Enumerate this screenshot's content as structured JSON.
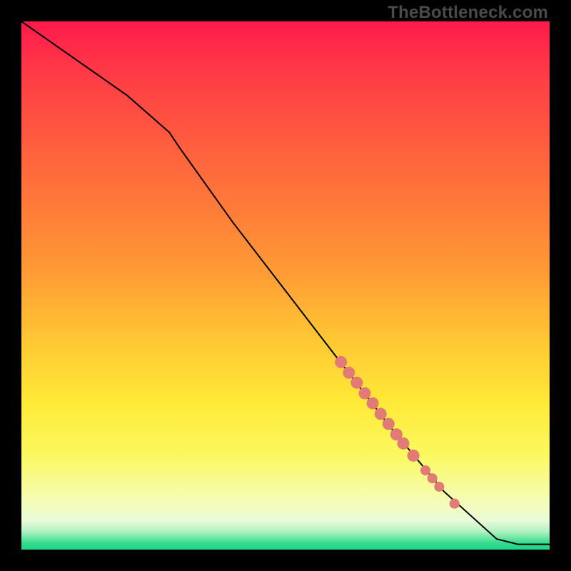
{
  "watermark": "TheBottleneck.com",
  "colors": {
    "background": "#000000",
    "line": "#000000",
    "marker": "#e27a76",
    "gradient_stops": [
      {
        "offset": 0.0,
        "color": "#ff1a4b"
      },
      {
        "offset": 0.1,
        "color": "#ff3b46"
      },
      {
        "offset": 0.22,
        "color": "#ff5a3f"
      },
      {
        "offset": 0.35,
        "color": "#ff7a39"
      },
      {
        "offset": 0.48,
        "color": "#ff9d35"
      },
      {
        "offset": 0.6,
        "color": "#ffc634"
      },
      {
        "offset": 0.72,
        "color": "#ffe937"
      },
      {
        "offset": 0.82,
        "color": "#fbf95f"
      },
      {
        "offset": 0.9,
        "color": "#f6fcae"
      },
      {
        "offset": 0.945,
        "color": "#eafbd8"
      },
      {
        "offset": 0.965,
        "color": "#b4f2c3"
      },
      {
        "offset": 0.978,
        "color": "#6be7a2"
      },
      {
        "offset": 0.988,
        "color": "#33db8e"
      },
      {
        "offset": 1.0,
        "color": "#1fd488"
      }
    ]
  },
  "chart_data": {
    "type": "line",
    "title": "",
    "xlabel": "",
    "ylabel": "",
    "xlim": [
      0,
      100
    ],
    "ylim": [
      0,
      100
    ],
    "grid": false,
    "series": [
      {
        "name": "curve",
        "x": [
          0,
          10,
          20,
          28,
          30,
          40,
          50,
          60,
          70,
          80,
          90,
          94,
          100
        ],
        "y": [
          100,
          93,
          86,
          79,
          76,
          62,
          49,
          36,
          23,
          11,
          2,
          1,
          1
        ]
      }
    ],
    "markers": {
      "name": "highlight-segment",
      "color": "#e27a76",
      "points": [
        {
          "x": 60.5,
          "y": 35.5
        },
        {
          "x": 62.0,
          "y": 33.5
        },
        {
          "x": 63.5,
          "y": 31.6
        },
        {
          "x": 65.0,
          "y": 29.6
        },
        {
          "x": 66.5,
          "y": 27.7
        },
        {
          "x": 68.0,
          "y": 25.7
        },
        {
          "x": 69.5,
          "y": 23.8
        },
        {
          "x": 71.0,
          "y": 21.8
        },
        {
          "x": 72.3,
          "y": 20.1
        },
        {
          "x": 74.2,
          "y": 17.8
        },
        {
          "x": 76.5,
          "y": 15.0
        },
        {
          "x": 77.8,
          "y": 13.5
        },
        {
          "x": 79.1,
          "y": 11.9
        },
        {
          "x": 82.0,
          "y": 8.7
        }
      ]
    }
  }
}
